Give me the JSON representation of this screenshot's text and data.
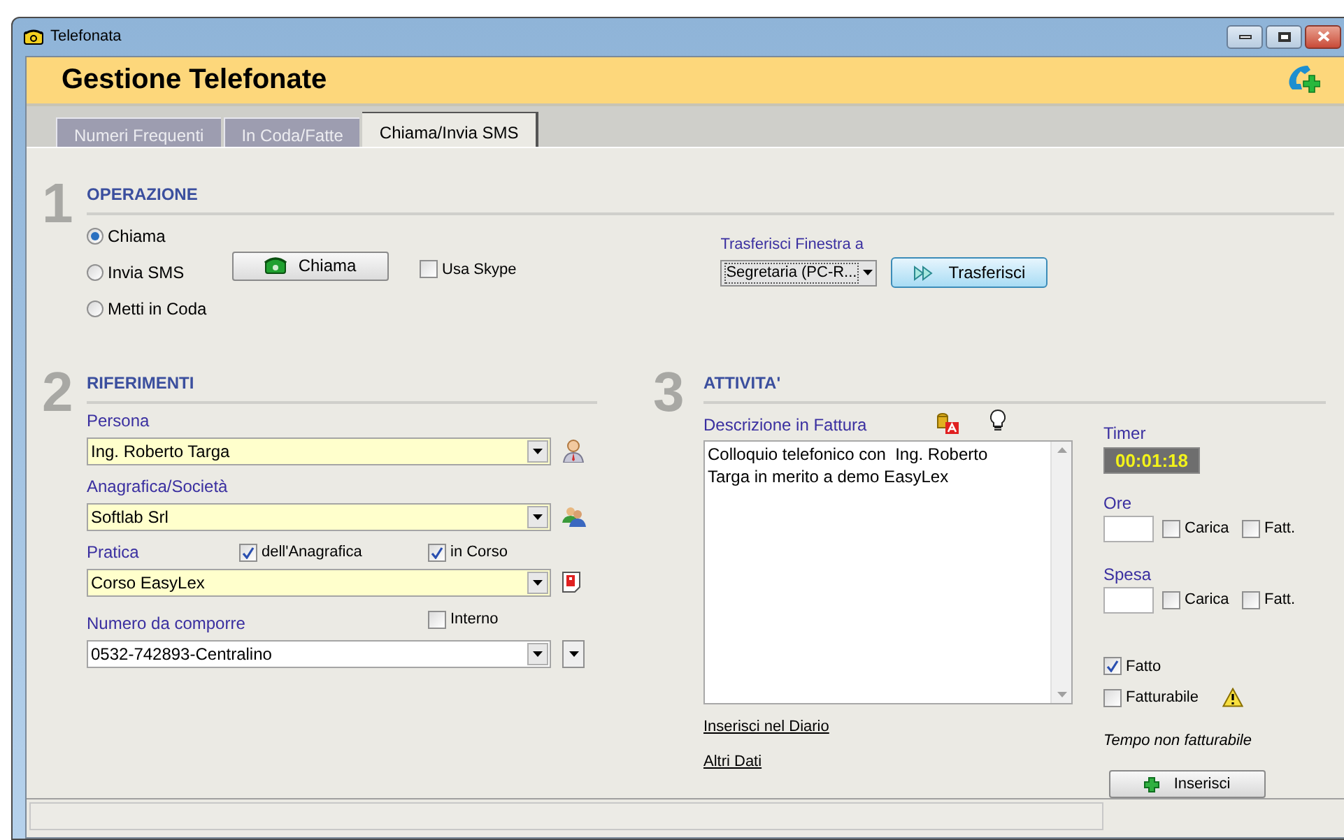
{
  "window": {
    "title": "Telefonata"
  },
  "header": {
    "title": "Gestione Telefonate"
  },
  "tabs": [
    {
      "label": "Numeri Frequenti",
      "selected": false
    },
    {
      "label": "In Coda/Fatte",
      "selected": false
    },
    {
      "label": "Chiama/Invia SMS",
      "selected": true
    }
  ],
  "operazione": {
    "number": "1",
    "title": "OPERAZIONE",
    "modes": [
      {
        "label": "Chiama",
        "selected": true
      },
      {
        "label": "Invia SMS",
        "selected": false
      },
      {
        "label": "Metti in Coda",
        "selected": false
      }
    ],
    "call_button": "Chiama",
    "skype": {
      "label": "Usa Skype",
      "checked": false
    },
    "transfer": {
      "label": "Trasferisci Finestra a",
      "value": "Segretaria (PC-R...",
      "button": "Trasferisci"
    }
  },
  "riferimenti": {
    "number": "2",
    "title": "RIFERIMENTI",
    "fields": [
      {
        "kind": "person",
        "label": "Persona",
        "value": "Ing. Roberto Targa"
      },
      {
        "kind": "company",
        "label": "Anagrafica/Società",
        "value": "Softlab Srl"
      },
      {
        "kind": "practice",
        "label": "Pratica",
        "value": "Corso EasyLex",
        "options": [
          {
            "label": "dell'Anagrafica",
            "checked": true
          },
          {
            "label": "in Corso",
            "checked": true
          }
        ]
      },
      {
        "kind": "number",
        "label": "Numero da comporre",
        "value": "0532-742893-Centralino",
        "options": [
          {
            "label": "Interno",
            "checked": false
          }
        ]
      }
    ]
  },
  "attivita": {
    "number": "3",
    "title": "ATTIVITA'",
    "description_label": "Descrizione in Fattura",
    "description": "Colloquio telefonico con  Ing. Roberto Targa in merito a demo EasyLex",
    "links": [
      "Inserisci nel Diario",
      "Altri Dati"
    ],
    "timer": {
      "label": "Timer",
      "value": "00:01:18"
    },
    "amounts": [
      {
        "label": "Ore",
        "checks": [
          {
            "label": "Carica",
            "checked": false
          },
          {
            "label": "Fatt.",
            "checked": false
          }
        ]
      },
      {
        "label": "Spesa",
        "checks": [
          {
            "label": "Carica",
            "checked": false
          },
          {
            "label": "Fatt.",
            "checked": false
          }
        ]
      }
    ],
    "flags": [
      {
        "label": "Fatto",
        "checked": true
      },
      {
        "label": "Fatturabile",
        "checked": false
      }
    ],
    "note": "Tempo non fatturabile",
    "insert_button": "Inserisci"
  }
}
